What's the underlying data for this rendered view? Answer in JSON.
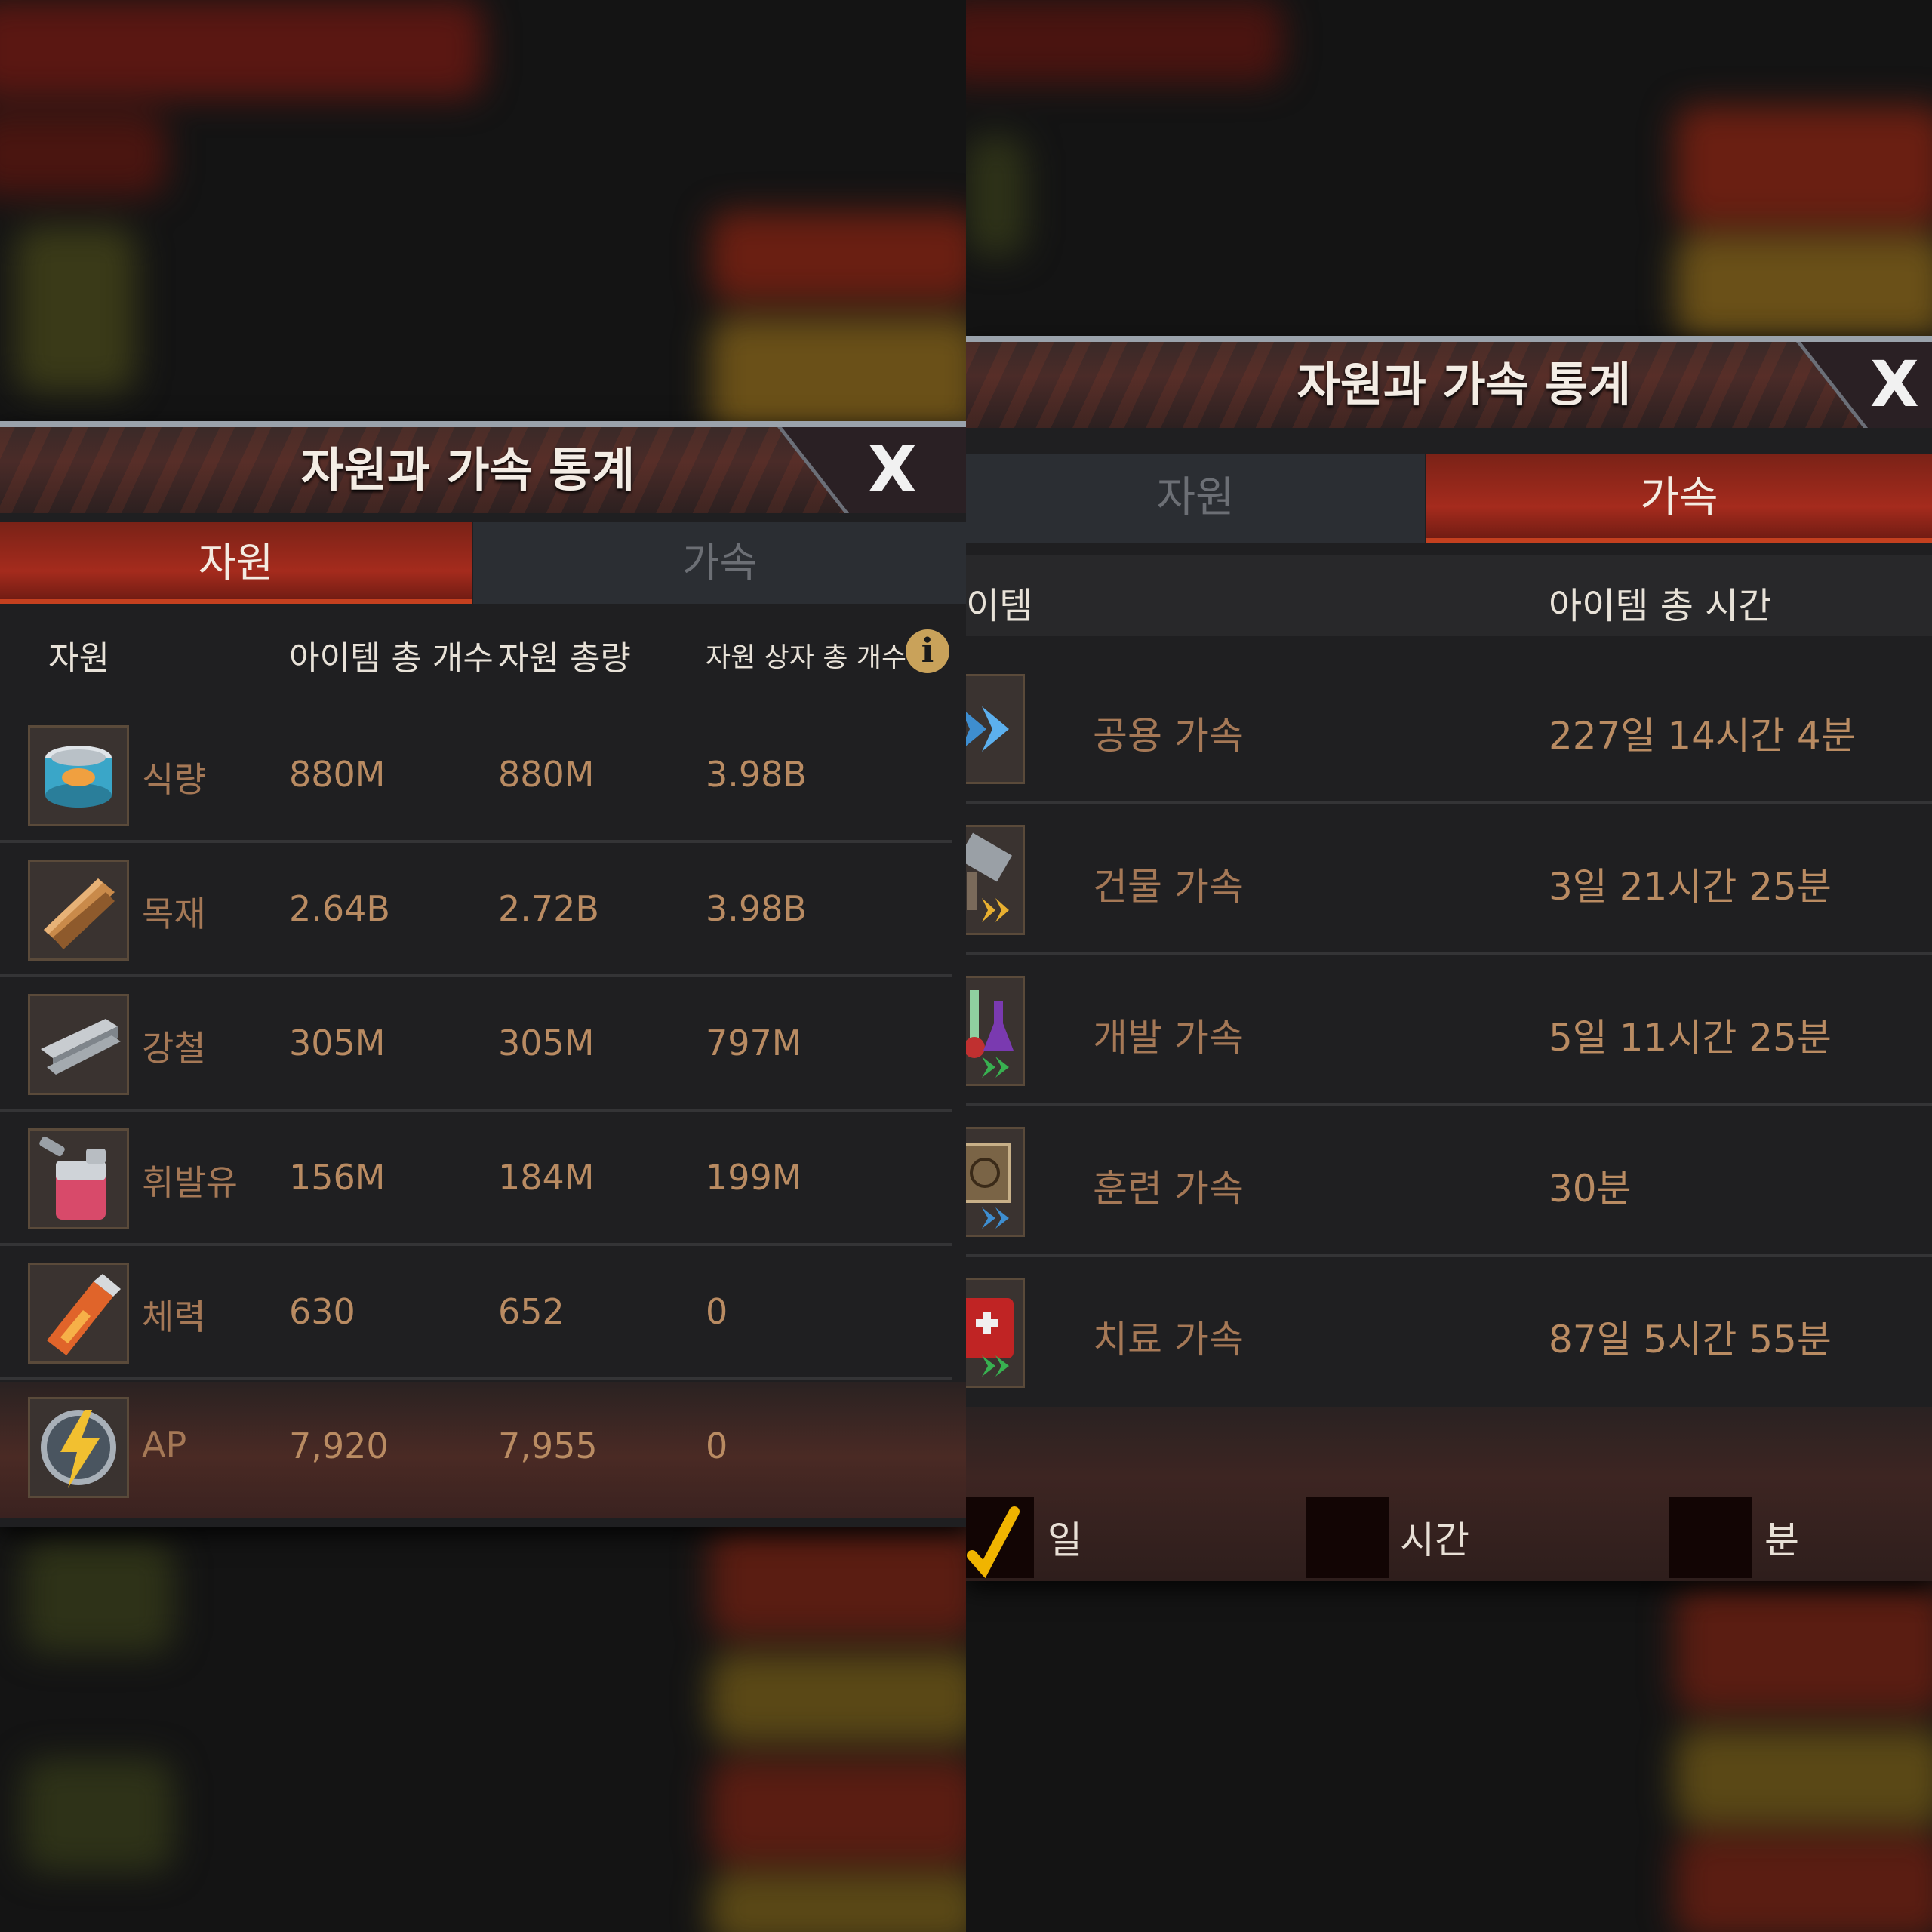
{
  "dialog_title": "자원과 가속 통계",
  "close_label": "X",
  "tabs": {
    "resources": "자원",
    "speedups": "가속"
  },
  "resources_view": {
    "headers": {
      "resource": "자원",
      "item_count": "아이템 총 개수",
      "resource_total": "자원 총량",
      "box_count": "자원 상자 총 개수"
    },
    "info_icon": "i",
    "rows": [
      {
        "icon": "food-can-icon",
        "name": "식량",
        "items": "880M",
        "total": "880M",
        "boxes": "3.98B"
      },
      {
        "icon": "wood-planks-icon",
        "name": "목재",
        "items": "2.64B",
        "total": "2.72B",
        "boxes": "3.98B"
      },
      {
        "icon": "steel-beam-icon",
        "name": "강철",
        "items": "305M",
        "total": "305M",
        "boxes": "797M"
      },
      {
        "icon": "fuel-can-icon",
        "name": "휘발유",
        "items": "156M",
        "total": "184M",
        "boxes": "199M"
      },
      {
        "icon": "energy-drink-icon",
        "name": "체력",
        "items": "630",
        "total": "652",
        "boxes": "0"
      },
      {
        "icon": "ap-lightning-icon",
        "name": "AP",
        "items": "7,920",
        "total": "7,955",
        "boxes": "0"
      }
    ]
  },
  "speedups_view": {
    "headers": {
      "item": "이템",
      "total_time": "아이템 총 시간"
    },
    "rows": [
      {
        "icon": "general-speedup-icon",
        "name": "공용 가속",
        "time": "227일 14시간 4분"
      },
      {
        "icon": "building-speedup-icon",
        "name": "건물 가속",
        "time": "3일 21시간 25분"
      },
      {
        "icon": "research-speedup-icon",
        "name": "개발 가속",
        "time": "5일 11시간 25분"
      },
      {
        "icon": "training-speedup-icon",
        "name": "훈련 가속",
        "time": "30분"
      },
      {
        "icon": "healing-speedup-icon",
        "name": "치료 가속",
        "time": "87일 5시간 55분"
      }
    ],
    "unit_toggles": [
      {
        "label": "일",
        "checked": true
      },
      {
        "label": "시간",
        "checked": false
      },
      {
        "label": "분",
        "checked": false
      }
    ]
  },
  "colors": {
    "accent_red": "#a52b1d",
    "value_text": "#b98b62",
    "check_yellow": "#f0b400"
  }
}
